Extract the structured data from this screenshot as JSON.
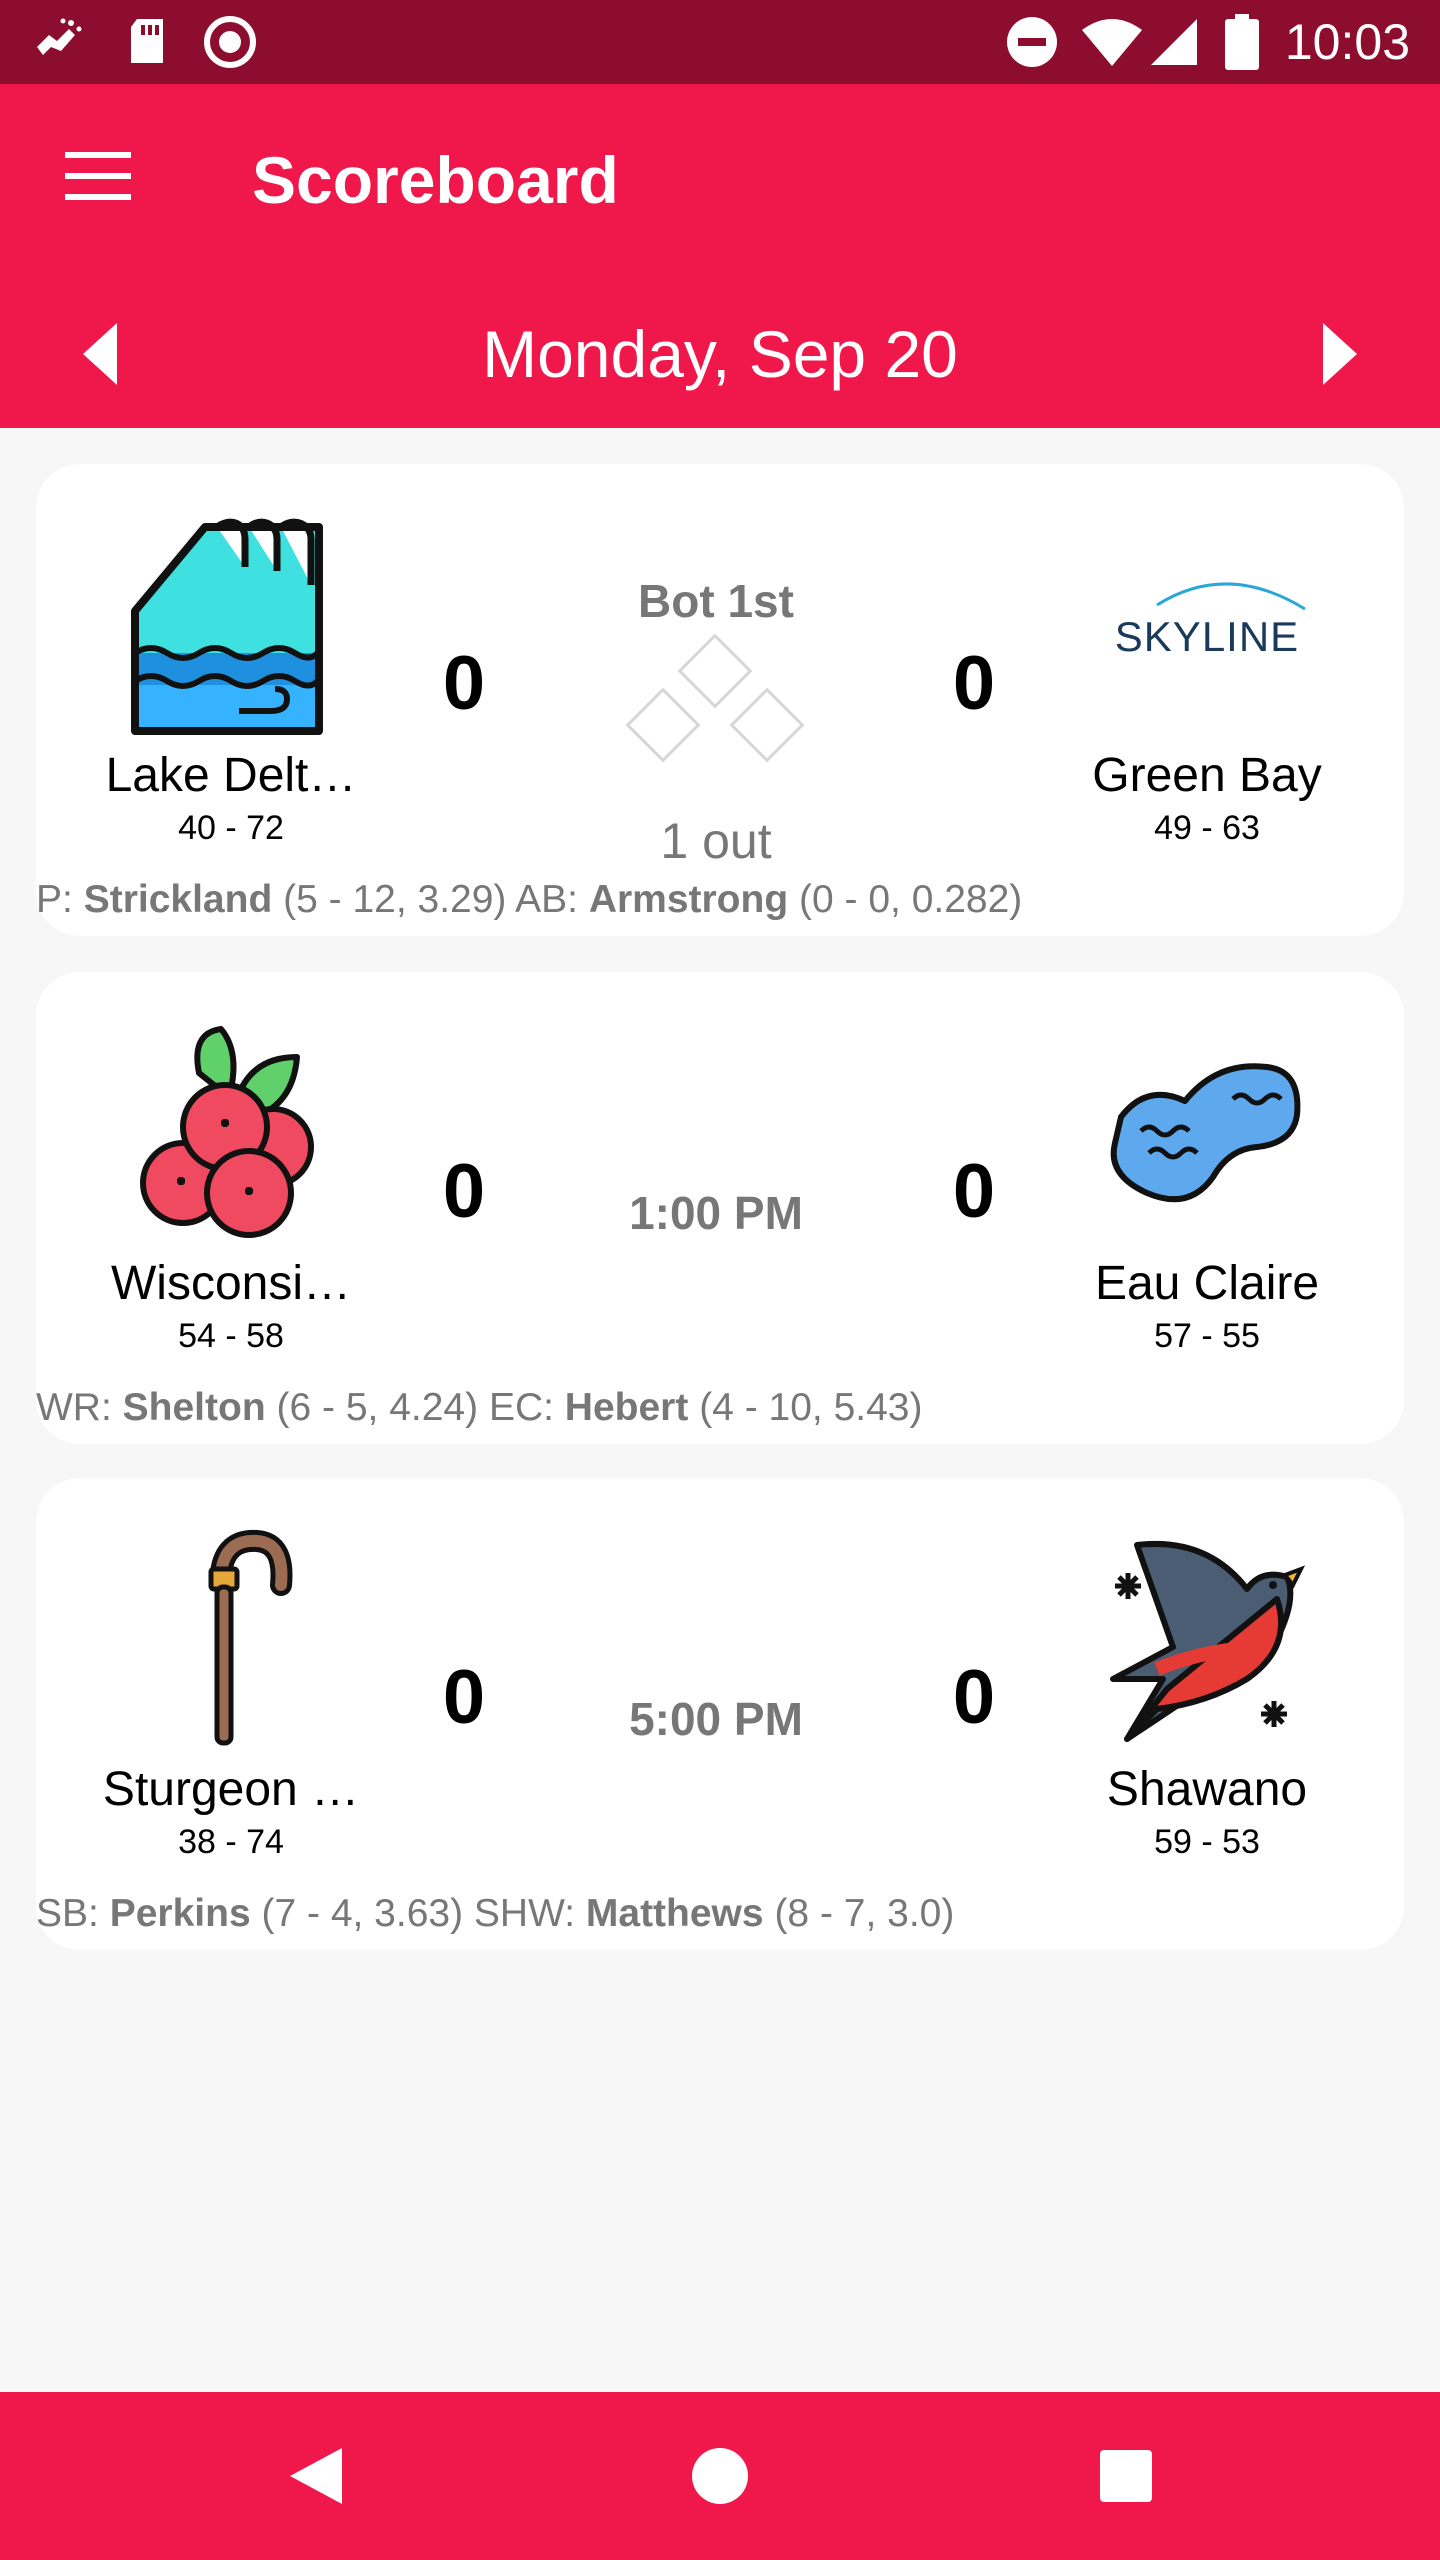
{
  "status_bar": {
    "time": "10:03",
    "left_icons": [
      "hand-wash-icon",
      "sd-card-icon",
      "record-icon"
    ],
    "right_icons": [
      "do-not-disturb-icon",
      "wifi-icon",
      "signal-icon",
      "battery-icon"
    ]
  },
  "app_bar": {
    "title": "Scoreboard",
    "menu_icon": "menu-icon",
    "date": "Monday, Sep 20",
    "prev_icon": "arrow-left-icon",
    "next_icon": "arrow-right-icon"
  },
  "games": [
    {
      "away": {
        "name": "Lake Delt…",
        "record": "40 - 72",
        "logo": "wave-icon",
        "score": "0"
      },
      "home": {
        "name": "Green Bay",
        "record": "49 - 63",
        "logo": "skyline-logo",
        "logo_text": "SKYLINE",
        "score": "0"
      },
      "status": "Bot 1st",
      "outs": "1 out",
      "p1_label": "P:",
      "p1_name": "Strickland",
      "p1_stats": "(5 - 12, 3.29)",
      "p2_label": "AB:",
      "p2_name": "Armstrong",
      "p2_stats": "(0 - 0, 0.282)"
    },
    {
      "away": {
        "name": "Wisconsi…",
        "record": "54 - 58",
        "logo": "cranberry-icon",
        "score": "0"
      },
      "home": {
        "name": "Eau Claire",
        "record": "57 - 55",
        "logo": "lake-icon",
        "score": "0"
      },
      "status": "1:00 PM",
      "p1_label": "WR:",
      "p1_name": "Shelton",
      "p1_stats": "(6 - 5, 4.24)",
      "p2_label": "EC:",
      "p2_name": "Hebert",
      "p2_stats": "(4 - 10, 5.43)"
    },
    {
      "away": {
        "name": "Sturgeon …",
        "record": "38 - 74",
        "logo": "cane-icon",
        "score": "0"
      },
      "home": {
        "name": "Shawano",
        "record": "59 - 53",
        "logo": "swallow-icon",
        "score": "0"
      },
      "status": "5:00 PM",
      "p1_label": "SB:",
      "p1_name": "Perkins",
      "p1_stats": "(7 - 4, 3.63)",
      "p2_label": "SHW:",
      "p2_name": "Matthews",
      "p2_stats": "(8 - 7, 3.0)"
    }
  ],
  "nav_bar": {
    "icons": [
      "back-icon",
      "home-icon",
      "recents-icon"
    ]
  },
  "colors": {
    "status_bar": "#8d0d2e",
    "primary": "#f0174b",
    "background": "#f7f7f7",
    "card": "#ffffff",
    "muted_text": "#777777"
  }
}
